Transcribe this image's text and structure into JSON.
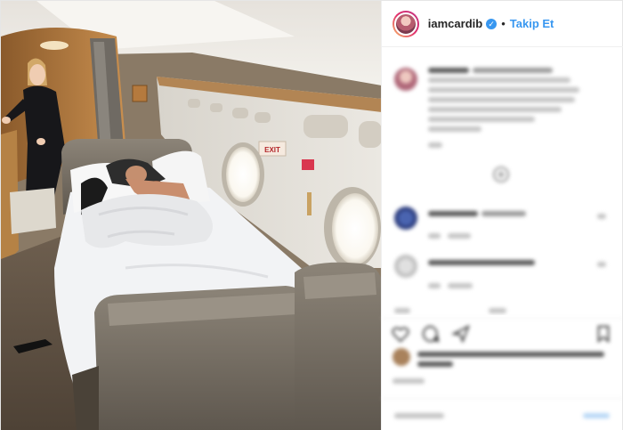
{
  "header": {
    "username": "iamcardib",
    "verified_icon": "verified-badge-icon",
    "separator": "•",
    "follow_label": "Takip Et"
  },
  "colors": {
    "accent": "#3897f0",
    "border": "#efefef",
    "text": "#262626"
  },
  "photo": {
    "exit_sign": "EXIT"
  },
  "icons": {
    "like": "heart-icon",
    "comment": "comment-icon",
    "share": "share-icon",
    "save": "bookmark-icon",
    "load_more": "plus-circle-icon",
    "comment_like": "small-heart-icon"
  }
}
